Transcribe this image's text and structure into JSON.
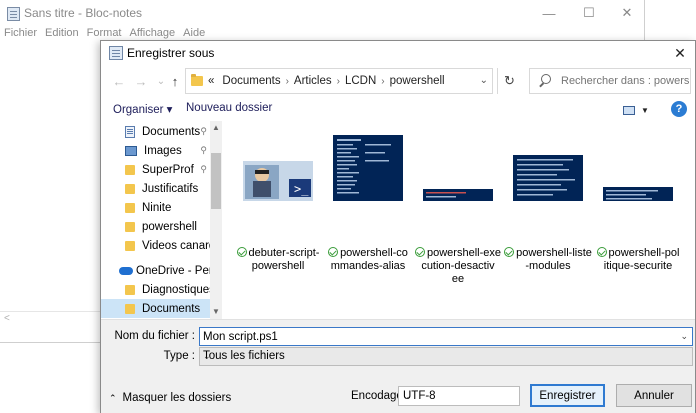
{
  "notepad": {
    "title": "Sans titre - Bloc-notes",
    "menu": [
      "Fichier",
      "Edition",
      "Format",
      "Affichage",
      "Aide"
    ],
    "controls": {
      "minimize": "—",
      "maximize": "☐",
      "close": "✕"
    },
    "scroll_left": "<"
  },
  "dialog": {
    "title": "Enregistrer sous",
    "close_glyph": "✕",
    "nav": {
      "back": "←",
      "forward": "→",
      "recent": "⌄",
      "up": "↑"
    },
    "breadcrumb": {
      "prefix": "«",
      "parts": [
        "Documents",
        "Articles",
        "LCDN",
        "powershell"
      ],
      "separator": "›"
    },
    "refresh_glyph": "↻",
    "search": {
      "placeholder": "Rechercher dans : powershell"
    },
    "toolbar": {
      "organize": "Organiser ▾",
      "new_folder": "Nouveau dossier",
      "help": "?"
    },
    "sidebar": {
      "items": [
        {
          "label": "Documents",
          "icon": "documents-icon",
          "pinned": true
        },
        {
          "label": "Images",
          "icon": "images-icon",
          "pinned": true
        },
        {
          "label": "SuperProf",
          "icon": "folder-icon",
          "pinned": true
        },
        {
          "label": "Justificatifs",
          "icon": "folder-icon",
          "pinned": false
        },
        {
          "label": "Ninite",
          "icon": "folder-icon",
          "pinned": false
        },
        {
          "label": "powershell",
          "icon": "folder-icon",
          "pinned": false
        },
        {
          "label": "Videos canard",
          "icon": "folder-icon",
          "pinned": false
        },
        {
          "label": "OneDrive - Person",
          "icon": "onedrive-icon",
          "pinned": false
        },
        {
          "label": "Diagnostiques A",
          "icon": "folder-icon",
          "pinned": false
        },
        {
          "label": "Documents",
          "icon": "folder-icon",
          "pinned": false,
          "selected": true
        }
      ],
      "pin_glyph": "📌"
    },
    "files": [
      {
        "line1": "debuter-script-",
        "line2": "powershell",
        "line3": ""
      },
      {
        "line1": "powershell-co",
        "line2": "mmandes-alias",
        "line3": ""
      },
      {
        "line1": "powershell-exe",
        "line2": "cution-desactiv",
        "line3": "ee"
      },
      {
        "line1": "powershell-liste",
        "line2": "-modules",
        "line3": ""
      },
      {
        "line1": "powershell-pol",
        "line2": "itique-securite",
        "line3": ""
      }
    ],
    "fields": {
      "filename_label": "Nom du fichier :",
      "filename_value": "Mon script.ps1",
      "type_label": "Type :",
      "type_value": "Tous les fichiers"
    },
    "footer": {
      "hide_folders": "Masquer les dossiers",
      "encoding_label": "Encodage :",
      "encoding_value": "UTF-8",
      "save": "Enregistrer",
      "cancel": "Annuler"
    },
    "colors": {
      "accent": "#2f7ad1",
      "selection": "#cce4f7",
      "folder": "#f3c64d"
    }
  }
}
